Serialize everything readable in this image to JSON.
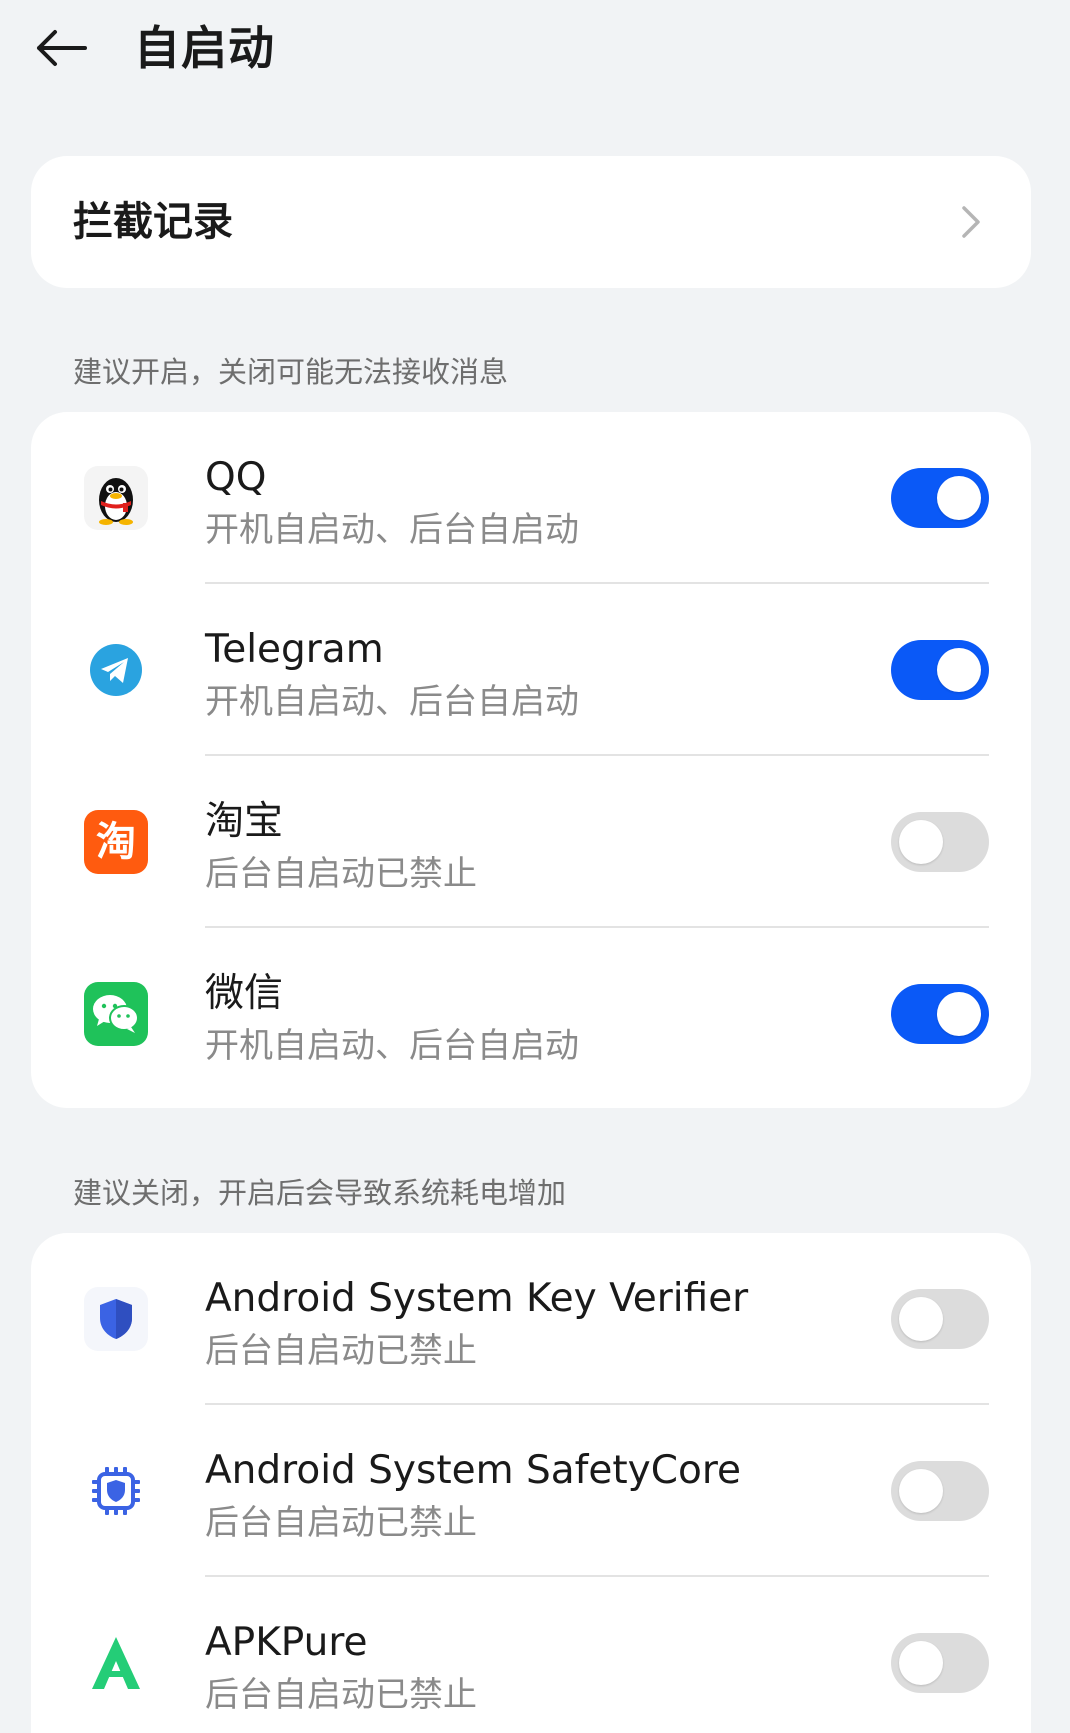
{
  "header": {
    "title": "自启动",
    "back_icon": "arrow-left-icon"
  },
  "intercept": {
    "label": "拦截记录",
    "chevron_icon": "chevron-right-icon"
  },
  "recommended_on": {
    "section_label": "建议开启，关闭可能无法接收消息",
    "items": [
      {
        "name": "QQ",
        "status": "开机自启动、后台自启动",
        "enabled": true,
        "icon": "qq-penguin-icon"
      },
      {
        "name": "Telegram",
        "status": "开机自启动、后台自启动",
        "enabled": true,
        "icon": "telegram-plane-icon"
      },
      {
        "name": "淘宝",
        "status": "后台自启动已禁止",
        "enabled": false,
        "icon": "taobao-icon",
        "icon_text": "淘"
      },
      {
        "name": "微信",
        "status": "开机自启动、后台自启动",
        "enabled": true,
        "icon": "wechat-icon"
      }
    ]
  },
  "recommended_off": {
    "section_label": "建议关闭，开启后会导致系统耗电增加",
    "items": [
      {
        "name": "Android System Key Verifier",
        "status": "后台自启动已禁止",
        "enabled": false,
        "icon": "shield-icon"
      },
      {
        "name": "Android System SafetyCore",
        "status": "后台自启动已禁止",
        "enabled": false,
        "icon": "chip-shield-icon"
      },
      {
        "name": "APKPure",
        "status": "后台自启动已禁止",
        "enabled": false,
        "icon": "apkpure-icon"
      }
    ]
  },
  "colors": {
    "background": "#f1f3f5",
    "card": "#ffffff",
    "toggle_on": "#0a59f7",
    "toggle_off": "#dcdcdc",
    "taobao": "#ff5b0f",
    "wechat": "#1fc25a",
    "telegram": "#2aa3e0",
    "android_shield": "#3b63e4"
  }
}
